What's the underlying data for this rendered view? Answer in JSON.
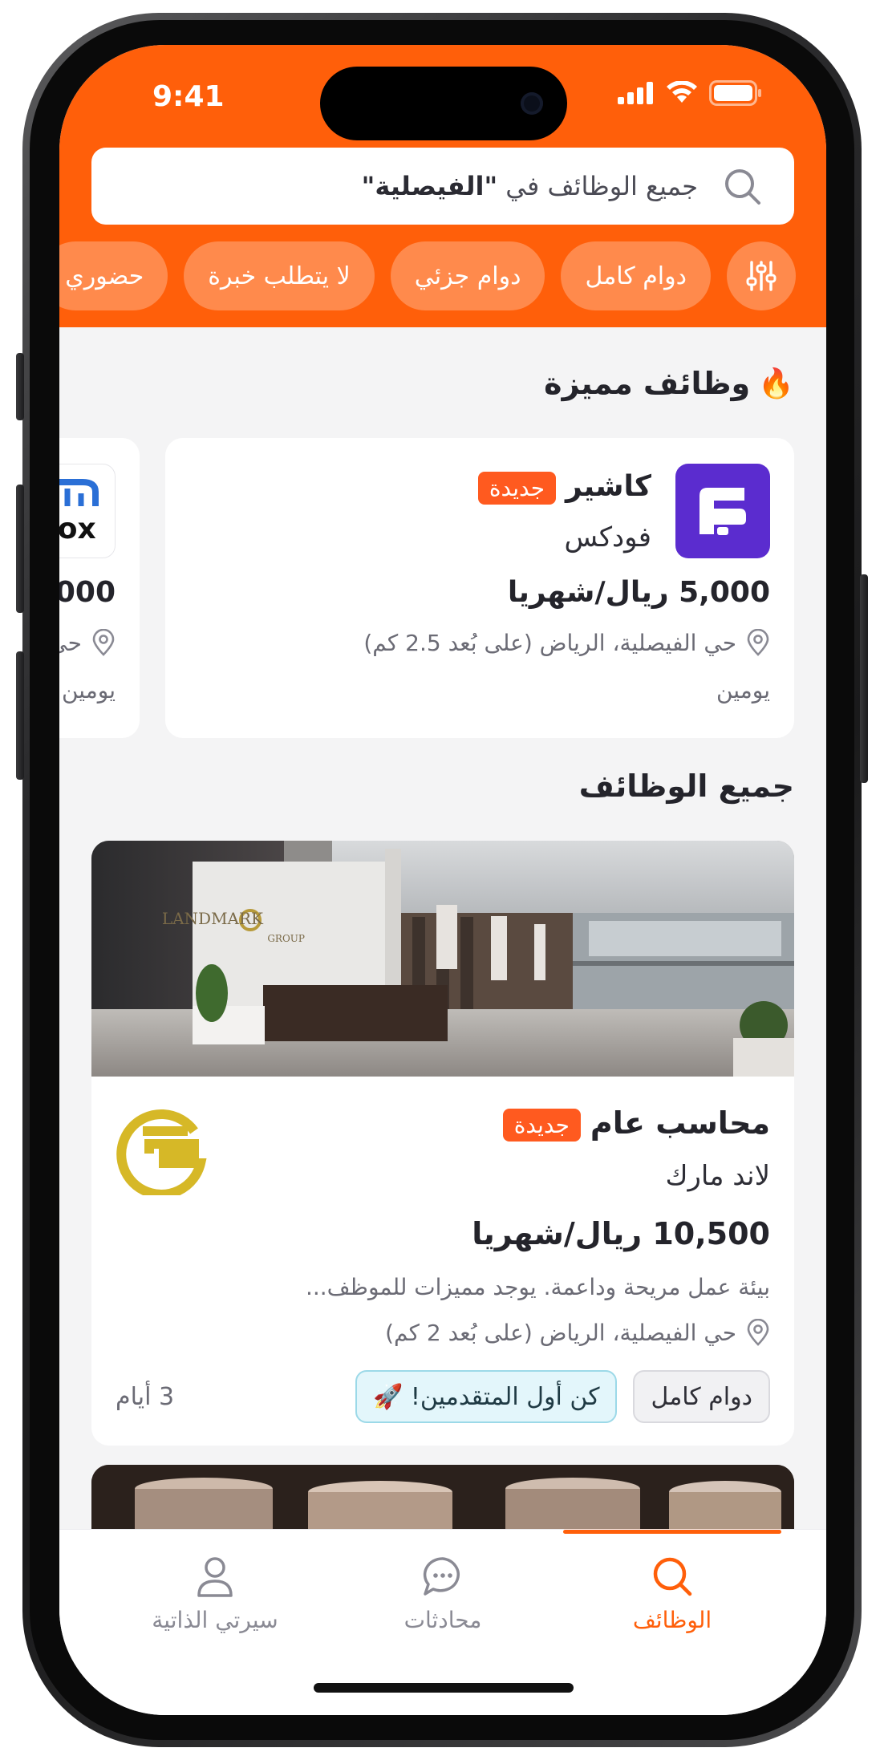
{
  "status": {
    "time": "9:41"
  },
  "search": {
    "prefix": "جميع الوظائف في ",
    "location": "\"الفيصلية\""
  },
  "filters": [
    "دوام كامل",
    "دوام جزئي",
    "لا يتطلب خبرة",
    "حضوري"
  ],
  "featured": {
    "title": "وظائف مميزة",
    "jobs": [
      {
        "title": "كاشير",
        "badge": "جديدة",
        "company": "فودكس",
        "salary": "5,000 ريال/شهريا",
        "location": "حي الفيصلية، الرياض (على بُعد 2.5 كم)",
        "posted": "يومين",
        "logo_color": "#5b2ccf"
      },
      {
        "logo_text": "vox",
        "salary": "000",
        "location": "حي",
        "posted": "يومين"
      }
    ]
  },
  "all_jobs": {
    "title": "جميع الوظائف",
    "jobs": [
      {
        "title": "محاسب عام",
        "badge": "جديدة",
        "company": "لاند مارك",
        "salary": "10,500 ريال/شهريا",
        "description": "بيئة عمل مريحة وداعمة. يوجد مميزات للموظف...",
        "location": "حي الفيصلية، الرياض (على بُعد 2 كم)",
        "tags": [
          "دوام كامل",
          "كن أول المتقدمين! 🚀"
        ],
        "posted": "3 أيام",
        "image_sign": "LANDMARK",
        "image_sign_sub": "GROUP"
      }
    ]
  },
  "tabs": [
    {
      "label": "الوظائف",
      "icon": "search-icon",
      "active": true
    },
    {
      "label": "محادثات",
      "icon": "chat-icon",
      "active": false
    },
    {
      "label": "سيرتي الذاتية",
      "icon": "person-icon",
      "active": false
    }
  ],
  "colors": {
    "brand": "#ff5f0a",
    "chip": "#ff8a4c",
    "badge": "#ff5a1f"
  }
}
